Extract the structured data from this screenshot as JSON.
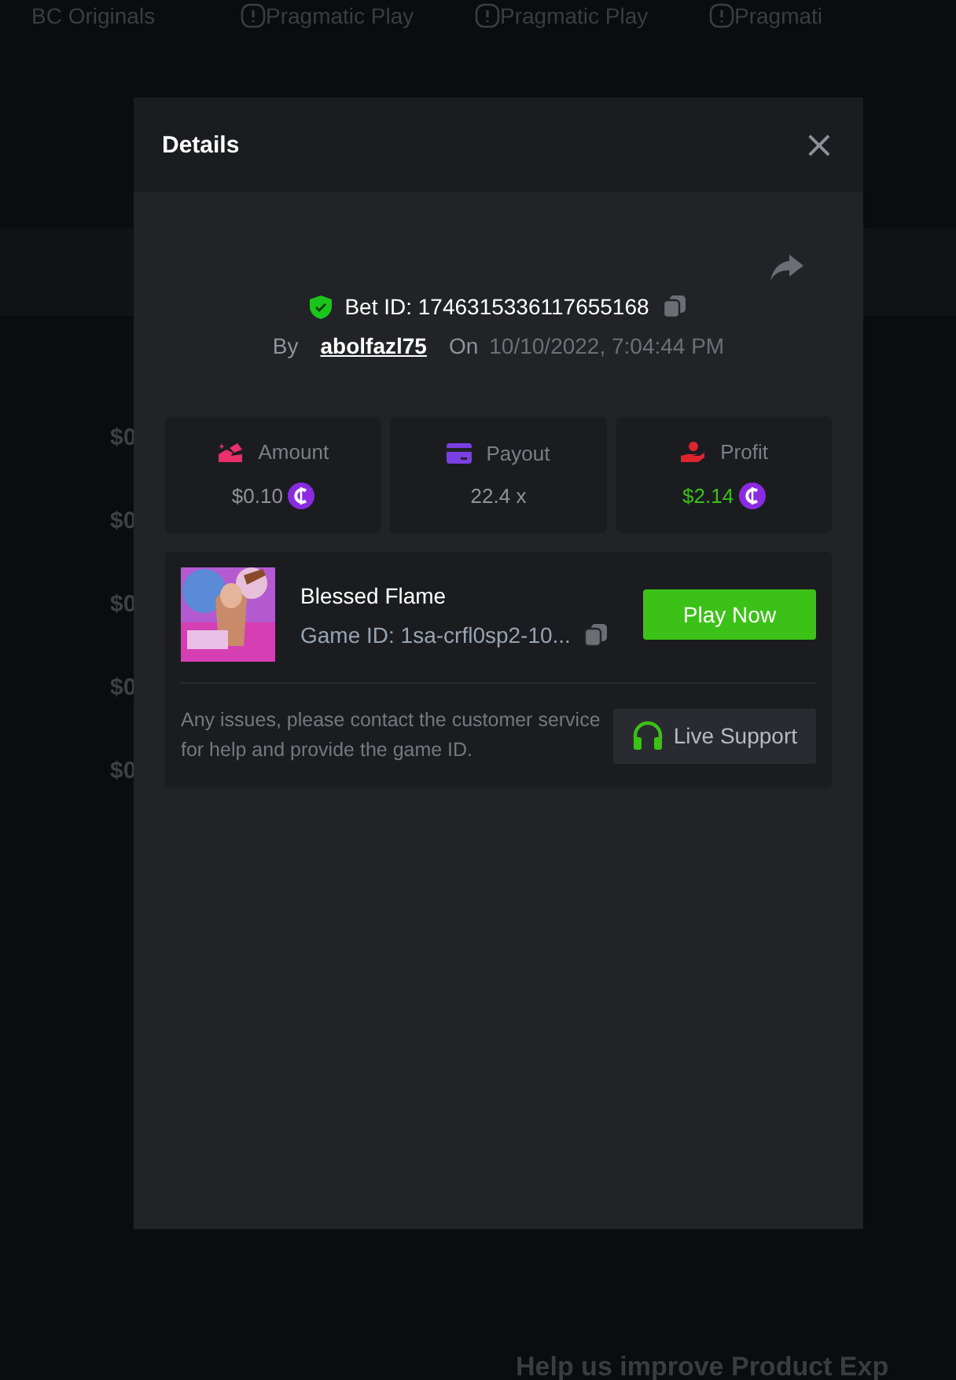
{
  "background": {
    "tabs": [
      {
        "label": "BC Originals"
      },
      {
        "label": "Pragmatic Play"
      },
      {
        "label": "Pragmatic Play"
      },
      {
        "label": "Pragmati"
      }
    ],
    "amounts": [
      "$0",
      "$0",
      "$0",
      "$0",
      "$0"
    ],
    "footer_heading": "Help us improve Product Exp"
  },
  "modal": {
    "title": "Details",
    "close": "×",
    "bet": {
      "id": "Bet ID: 1746315336117655168",
      "by_label": "By",
      "user": "abolfazl75",
      "on_label": "On",
      "date": "10/10/2022, 7:04:44 PM"
    },
    "stats": [
      {
        "kind": "amount",
        "label": "Amount",
        "value": "$0.10",
        "coin": true,
        "positive": false
      },
      {
        "kind": "payout",
        "label": "Payout",
        "value": "22.4 x",
        "coin": false,
        "positive": false
      },
      {
        "kind": "profit",
        "label": "Profit",
        "value": "$2.14",
        "coin": true,
        "positive": true
      }
    ],
    "game": {
      "name": "Blessed Flame",
      "id": "Game ID: 1sa-crfl0sp2-10...",
      "play_button": "Play Now",
      "notice": "Any issues, please contact the customer service for help and provide the game ID.",
      "support_button": "Live Support"
    }
  }
}
